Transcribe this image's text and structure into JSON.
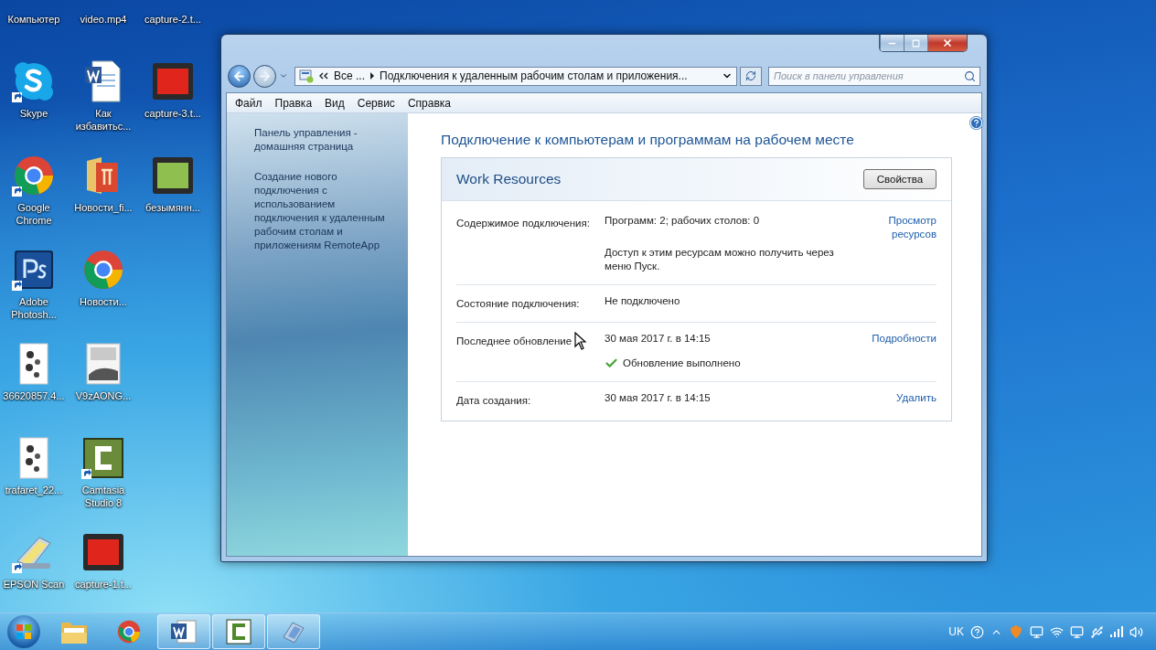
{
  "desktop": {
    "columns": [
      [
        {
          "label": "Компьютер"
        },
        {
          "label": "Skype",
          "kind": "skype",
          "shortcut": true
        },
        {
          "label": "Google Chrome",
          "kind": "chrome",
          "shortcut": true
        },
        {
          "label": "Adobe Photosh...",
          "kind": "photoshop",
          "shortcut": true
        },
        {
          "label": "36620857.4...",
          "kind": "image"
        },
        {
          "label": "trafaret_22...",
          "kind": "image"
        },
        {
          "label": "EPSON Scan",
          "kind": "scanner",
          "shortcut": true
        }
      ],
      [
        {
          "label": "video.mp4"
        },
        {
          "label": "Как избавитьс...",
          "kind": "word"
        },
        {
          "label": "Новости_fi...",
          "kind": "folder"
        },
        {
          "label": "Новости...",
          "kind": "chrome"
        },
        {
          "label": "V9zAONG...",
          "kind": "photo"
        },
        {
          "label": "Camtasia Studio 8",
          "kind": "camtasia",
          "shortcut": true
        },
        {
          "label": "capture-1.t...",
          "kind": "redvideo"
        }
      ],
      [
        {
          "label": "capture-2.t..."
        },
        {
          "label": "capture-3.t...",
          "kind": "redvideo"
        },
        {
          "label": "безымянн...",
          "kind": "greenvideo"
        }
      ]
    ]
  },
  "window": {
    "address": {
      "crumbs": [
        "Все ...",
        "Подключения к удаленным рабочим столам и приложения..."
      ]
    },
    "search": {
      "placeholder": "Поиск в панели управления"
    },
    "menu": [
      "Файл",
      "Правка",
      "Вид",
      "Сервис",
      "Справка"
    ],
    "sidebar": [
      "Панель управления - домашняя страница",
      "Создание нового подключения с использованием подключения к удаленным рабочим столам и приложениям RemoteApp"
    ],
    "heading": "Подключение к компьютерам и программам на рабочем месте",
    "panel": {
      "title": "Work Resources",
      "button": "Свойства",
      "rows": [
        {
          "label": "Содержимое подключения:",
          "lines": [
            "Программ: 2; рабочих столов: 0",
            "Доступ к этим ресурсам можно получить через меню Пуск."
          ],
          "link": "Просмотр ресурсов"
        },
        {
          "label": "Состояние подключения:",
          "lines": [
            "Не подключено"
          ]
        },
        {
          "label": "Последнее обновление",
          "lines": [
            "30 мая 2017 г. в 14:15"
          ],
          "status": {
            "text": "Обновление выполнено",
            "ok": true
          },
          "link": "Подробности",
          "cursor": true
        },
        {
          "label": "Дата создания:",
          "lines": [
            "30 мая 2017 г. в 14:15"
          ],
          "link": "Удалить"
        }
      ]
    }
  },
  "taskbar": {
    "items": [
      {
        "kind": "folder",
        "open": false
      },
      {
        "kind": "chrome",
        "open": false
      },
      {
        "kind": "word",
        "open": true
      },
      {
        "kind": "camtasia",
        "open": true
      },
      {
        "kind": "remote",
        "open": true
      }
    ],
    "language": "UK"
  }
}
